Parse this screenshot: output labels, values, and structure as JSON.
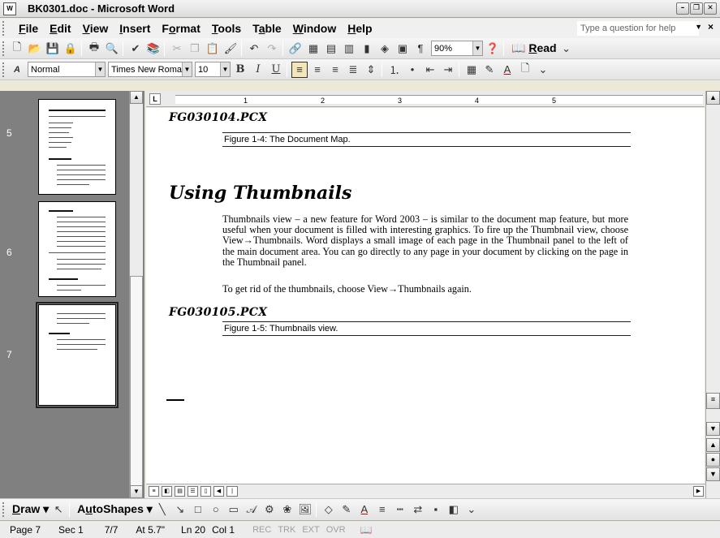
{
  "window": {
    "title": "BK0301.doc - Microsoft Word",
    "app_icon": "W"
  },
  "menubar": {
    "items": [
      {
        "pre": "",
        "u": "F",
        "post": "ile"
      },
      {
        "pre": "",
        "u": "E",
        "post": "dit"
      },
      {
        "pre": "",
        "u": "V",
        "post": "iew"
      },
      {
        "pre": "",
        "u": "I",
        "post": "nsert"
      },
      {
        "pre": "F",
        "u": "o",
        "post": "rmat"
      },
      {
        "pre": "",
        "u": "T",
        "post": "ools"
      },
      {
        "pre": "T",
        "u": "a",
        "post": "ble"
      },
      {
        "pre": "",
        "u": "W",
        "post": "indow"
      },
      {
        "pre": "",
        "u": "H",
        "post": "elp"
      }
    ],
    "ask_placeholder": "Type a question for help",
    "close_glyph": "×"
  },
  "standard_toolbar": {
    "zoom": "90%",
    "read_pre": "",
    "read_u": "R",
    "read_post": "ead"
  },
  "format_toolbar": {
    "style": "Normal",
    "font": "Times New Roman",
    "size": "10"
  },
  "thumbnails": [
    {
      "page": "5"
    },
    {
      "page": "6"
    },
    {
      "page": "7"
    }
  ],
  "ruler": {
    "numbers": [
      "1",
      "2",
      "3",
      "4",
      "5"
    ]
  },
  "document": {
    "fig1_code": "FG030104.PCX",
    "fig1_caption": "Figure 1-4: The Document Map.",
    "heading": "Using Thumbnails",
    "para1": "Thumbnails view – a new feature for Word 2003 – is similar to the document map feature, but more useful when your document is filled with interesting graphics. To fire up the Thumbnail view, choose View→Thumbnails. Word displays a small image of each page in the Thumbnail panel to the left of the main document area. You can go directly to any page in your document by clicking on the page in the Thumbnail panel.",
    "para2": "To get rid of the thumbnails, choose View→Thumbnails again.",
    "fig2_code": "FG030105.PCX",
    "fig2_caption": "Figure 1-5: Thumbnails view."
  },
  "drawing_toolbar": {
    "draw_u": "D",
    "draw_post": "raw",
    "autoshapes_pre": "A",
    "autoshapes_u": "u",
    "autoshapes_post": "toShapes"
  },
  "statusbar": {
    "page": "Page 7",
    "sec": "Sec 1",
    "of": "7/7",
    "at": "At 5.7\"",
    "ln": "Ln 20",
    "col": "Col 1",
    "rec": "REC",
    "trk": "TRK",
    "ext": "EXT",
    "ovr": "OVR"
  }
}
